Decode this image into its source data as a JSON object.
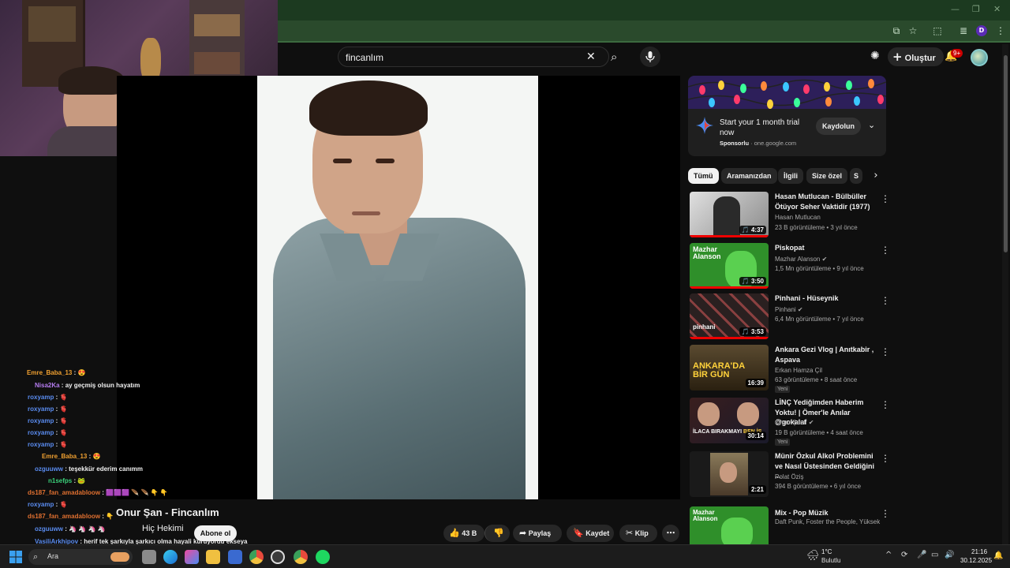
{
  "browser": {
    "window_controls": [
      "—",
      "❐",
      "✕"
    ],
    "profile_initial": "D"
  },
  "youtube": {
    "search_query": "fincanlım",
    "create_label": "Oluştur",
    "notif_count": "9+"
  },
  "chat": [
    {
      "user": "Emre_Baba_13",
      "message": "😍",
      "color": "#f0a030"
    },
    {
      "user": "Nisa2Ka",
      "message": "ay geçmiş olsun hayatım",
      "color": "#b57cf0"
    },
    {
      "user": "roxyamp",
      "message": "🫀",
      "color": "#5a8cf0"
    },
    {
      "user": "roxyamp",
      "message": "🫀",
      "color": "#5a8cf0"
    },
    {
      "user": "roxyamp",
      "message": "🫀",
      "color": "#5a8cf0"
    },
    {
      "user": "roxyamp",
      "message": "🫀",
      "color": "#5a8cf0"
    },
    {
      "user": "roxyamp",
      "message": "🫀",
      "color": "#5a8cf0"
    },
    {
      "user": "Emre_Baba_13",
      "message": "😍",
      "color": "#f0a030"
    },
    {
      "user": "ozguuww",
      "message": "teşekkür ederim canımm",
      "color": "#5a8cf0"
    },
    {
      "user": "n1sefps",
      "message": "🐸",
      "color": "#3ad07a"
    },
    {
      "user": "ds187_fan_amadabloow",
      "message": "🟪🟪🟪 🪶 🪶 👇 👇",
      "color": "#e07030"
    },
    {
      "user": "roxyamp",
      "message": "🫀",
      "color": "#5a8cf0"
    },
    {
      "user": "ds187_fan_amadabloow",
      "message": "👇",
      "color": "#e07030"
    },
    {
      "user": "ozguuww",
      "message": "🦄 🦄 🦄 🦄",
      "color": "#5a8cf0"
    },
    {
      "user": "VasiliArkhipov",
      "message": "herif tek şarkıyla şarkıcı olma hayali kuruyordu ekseya durağında inanılmaz fdghjklşkjhbgfds",
      "color": "#5a8cf0"
    }
  ],
  "video": {
    "title": "Onur Şan - Fincanlım",
    "channel": "Hiç Hekimi",
    "subscribe": "Abone ol",
    "likes": "43 B",
    "share": "Paylaş",
    "save": "Kaydet",
    "clip": "Klip"
  },
  "ad": {
    "title": "Start your 1 month trial now",
    "sponsored": "Sponsorlu",
    "domain": "one.google.com",
    "cta": "Kaydolun"
  },
  "chips": [
    "Tümü",
    "Aramanızdan",
    "İlgili",
    "Size özel",
    "S"
  ],
  "recommendations": [
    {
      "title": "Hasan Mutlucan - Bülbüller Ötüyor Seher Vaktidir (1977)",
      "channel": "Hasan Mutlucan",
      "verified": false,
      "views": "23 B görüntüleme",
      "age": "3 yıl önce",
      "duration": "4:37",
      "new": "",
      "thumb_color": "#c8c8c8"
    },
    {
      "title": "Piskopat",
      "channel": "Mazhar Alanson",
      "verified": true,
      "views": "1,5 Mn görüntüleme",
      "age": "9 yıl önce",
      "duration": "3:50",
      "new": "",
      "thumb_color": "#2d8a2a"
    },
    {
      "title": "Pinhani - Hüseynik",
      "channel": "Pinhani",
      "verified": true,
      "views": "6,4 Mn görüntüleme",
      "age": "7 yıl önce",
      "duration": "3:53",
      "new": "",
      "thumb_color": "#3a2a2a"
    },
    {
      "title": "Ankara Gezi Vlog | Anıtkabir , Aspava",
      "channel": "Erkan Hamza Çil",
      "verified": false,
      "views": "63 görüntüleme",
      "age": "8 saat önce",
      "duration": "16:39",
      "new": "Yeni",
      "thumb_color": "#4a3a20"
    },
    {
      "title": "LİNÇ Yediğimden Haberim Yoktu! | Ömer'le Anılar @gokalaf",
      "channel": "Ömer Şanlı",
      "verified": true,
      "views": "19 B görüntüleme",
      "age": "4 saat önce",
      "duration": "30:14",
      "new": "Yeni",
      "thumb_color": "#a03020"
    },
    {
      "title": "Münir Özkul Alkol Problemini ve Nasıl Üstesinden Geldiğini ...",
      "channel": "Polat Öziş",
      "verified": false,
      "views": "394 B görüntüleme",
      "age": "6 yıl önce",
      "duration": "2:21",
      "new": "",
      "thumb_color": "#6a5a40"
    },
    {
      "title": "Mix - Pop Müzik",
      "channel": "Daft Punk, Foster the People, Yüksek Sa...",
      "verified": false,
      "views": "",
      "age": "",
      "duration": "",
      "new": "",
      "thumb_color": "#2d8a2a"
    }
  ],
  "taskbar": {
    "search_placeholder": "Ara",
    "weather_temp": "1°C",
    "weather_desc": "Bulutlu",
    "time": "21:16",
    "date": "30.12.2025"
  }
}
